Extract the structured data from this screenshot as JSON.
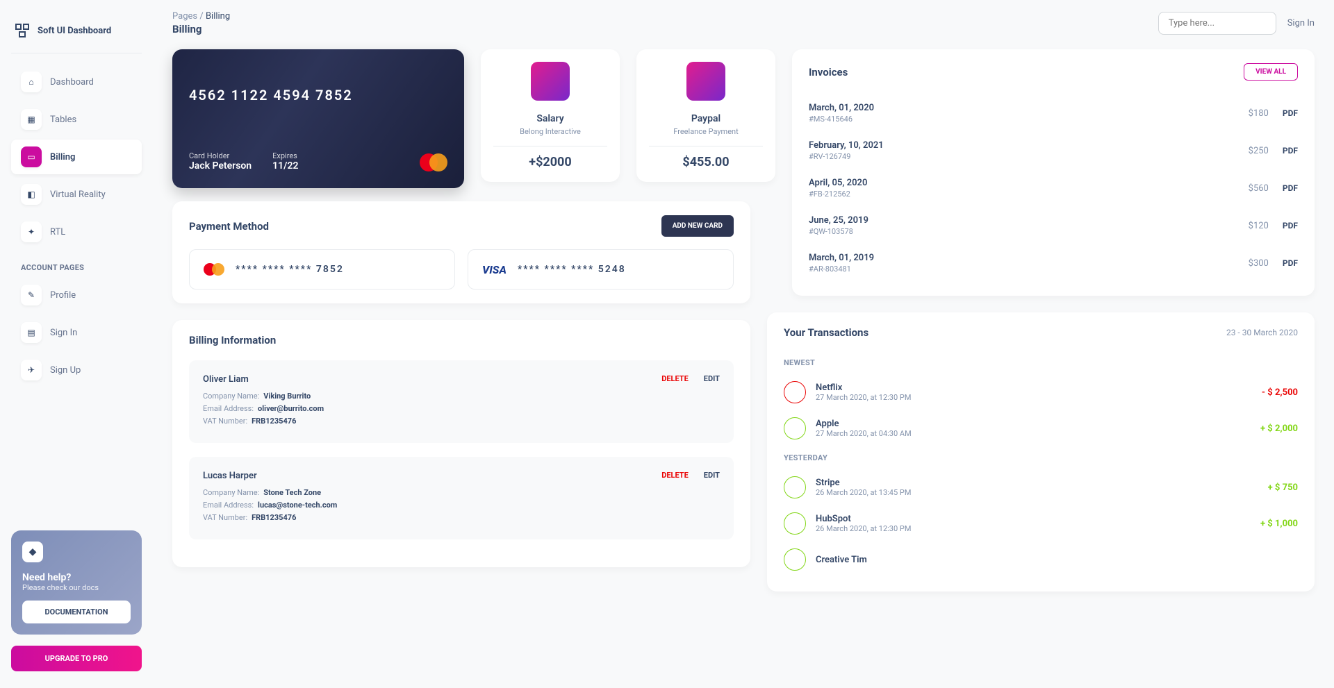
{
  "brand": "Soft UI Dashboard",
  "nav": {
    "items": [
      {
        "label": "Dashboard",
        "icon": "⌂"
      },
      {
        "label": "Tables",
        "icon": "▦"
      },
      {
        "label": "Billing",
        "icon": "▭"
      },
      {
        "label": "Virtual Reality",
        "icon": "◧"
      },
      {
        "label": "RTL",
        "icon": "✦"
      }
    ],
    "heading": "ACCOUNT PAGES",
    "account": [
      {
        "label": "Profile",
        "icon": "✎"
      },
      {
        "label": "Sign In",
        "icon": "▤"
      },
      {
        "label": "Sign Up",
        "icon": "✈"
      }
    ]
  },
  "help": {
    "title": "Need help?",
    "sub": "Please check our docs",
    "btn": "DOCUMENTATION"
  },
  "upgrade": "UPGRADE TO PRO",
  "breadcrumb": {
    "root": "Pages",
    "current": "Billing"
  },
  "pageTitle": "Billing",
  "search": {
    "placeholder": "Type here..."
  },
  "signin": "Sign In",
  "creditCard": {
    "number": "4562   1122   4594   7852",
    "holderLabel": "Card Holder",
    "holder": "Jack Peterson",
    "expiresLabel": "Expires",
    "expires": "11/22"
  },
  "miniCards": [
    {
      "title": "Salary",
      "sub": "Belong Interactive",
      "amount": "+$2000"
    },
    {
      "title": "Paypal",
      "sub": "Freelance Payment",
      "amount": "$455.00"
    }
  ],
  "invoices": {
    "title": "Invoices",
    "viewAll": "VIEW ALL",
    "list": [
      {
        "date": "March, 01, 2020",
        "id": "#MS-415646",
        "amount": "$180",
        "pdf": "PDF"
      },
      {
        "date": "February, 10, 2021",
        "id": "#RV-126749",
        "amount": "$250",
        "pdf": "PDF"
      },
      {
        "date": "April, 05, 2020",
        "id": "#FB-212562",
        "amount": "$560",
        "pdf": "PDF"
      },
      {
        "date": "June, 25, 2019",
        "id": "#QW-103578",
        "amount": "$120",
        "pdf": "PDF"
      },
      {
        "date": "March, 01, 2019",
        "id": "#AR-803481",
        "amount": "$300",
        "pdf": "PDF"
      }
    ]
  },
  "payment": {
    "title": "Payment Method",
    "addBtn": "ADD NEW CARD",
    "cards": [
      {
        "brand": "mastercard",
        "number": "****   ****   ****   7852"
      },
      {
        "brand": "visa",
        "number": "****   ****   ****   5248"
      }
    ]
  },
  "billing": {
    "title": "Billing Information",
    "delete": "DELETE",
    "edit": "EDIT",
    "labels": {
      "company": "Company Name:",
      "email": "Email Address:",
      "vat": "VAT Number:"
    },
    "entries": [
      {
        "name": "Oliver Liam",
        "company": "Viking Burrito",
        "email": "oliver@burrito.com",
        "vat": "FRB1235476"
      },
      {
        "name": "Lucas Harper",
        "company": "Stone Tech Zone",
        "email": "lucas@stone-tech.com",
        "vat": "FRB1235476"
      }
    ]
  },
  "tx": {
    "title": "Your Transactions",
    "range": "23 - 30 March 2020",
    "sections": {
      "newest": "NEWEST",
      "yesterday": "YESTERDAY"
    },
    "newest": [
      {
        "name": "Netflix",
        "date": "27 March 2020, at 12:30 PM",
        "amount": "- $ 2,500",
        "dir": "down"
      },
      {
        "name": "Apple",
        "date": "27 March 2020, at 04:30 AM",
        "amount": "+ $ 2,000",
        "dir": "up"
      }
    ],
    "yesterday": [
      {
        "name": "Stripe",
        "date": "26 March 2020, at 13:45 PM",
        "amount": "+ $ 750",
        "dir": "up"
      },
      {
        "name": "HubSpot",
        "date": "26 March 2020, at 12:30 PM",
        "amount": "+ $ 1,000",
        "dir": "up"
      },
      {
        "name": "Creative Tim",
        "date": "",
        "amount": "",
        "dir": "up"
      }
    ]
  }
}
